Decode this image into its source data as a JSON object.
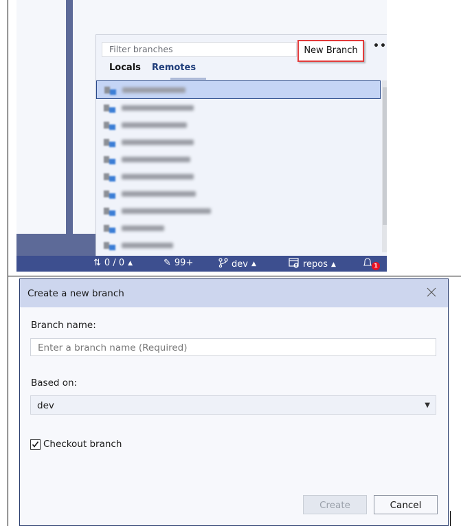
{
  "branch_panel": {
    "filter_placeholder": "Filter branches",
    "new_branch_label": "New Branch",
    "more_label": "•••",
    "tabs": [
      {
        "label": "Locals",
        "active": false
      },
      {
        "label": "Remotes",
        "active": true
      }
    ],
    "branches": [
      {
        "name": "[blurred]",
        "selected": true
      },
      {
        "name": "[blurred]",
        "selected": false
      },
      {
        "name": "[blurred]",
        "selected": false
      },
      {
        "name": "[blurred]",
        "selected": false
      },
      {
        "name": "[blurred]",
        "selected": false
      },
      {
        "name": "[blurred]",
        "selected": false
      },
      {
        "name": "[blurred]",
        "selected": false
      },
      {
        "name": "[blurred]",
        "selected": false
      },
      {
        "name": "[blurred]",
        "selected": false
      },
      {
        "name": "[blurred]",
        "selected": false
      }
    ]
  },
  "status_bar": {
    "sync": {
      "icon": "up-down-arrows-icon",
      "label": "0 / 0"
    },
    "changes": {
      "icon": "pencil-icon",
      "label": "99+"
    },
    "branch": {
      "icon": "git-branch-icon",
      "label": "dev"
    },
    "repo": {
      "icon": "repository-icon",
      "label": "repos"
    },
    "notifications": {
      "icon": "bell-icon",
      "count": "1"
    },
    "caret": "▲"
  },
  "dialog": {
    "title": "Create a new branch",
    "branch_name_label": "Branch name:",
    "branch_name_placeholder": "Enter a branch name (Required)",
    "based_on_label": "Based on:",
    "based_on_value": "dev",
    "checkout_label": "Checkout branch",
    "checkout_checked": true,
    "create_label": "Create",
    "cancel_label": "Cancel"
  },
  "colors": {
    "status_bar": "#3d4f8f",
    "highlight_border": "#e23b3b",
    "dialog_header": "#cdd6ee",
    "badge": "#e81123"
  }
}
